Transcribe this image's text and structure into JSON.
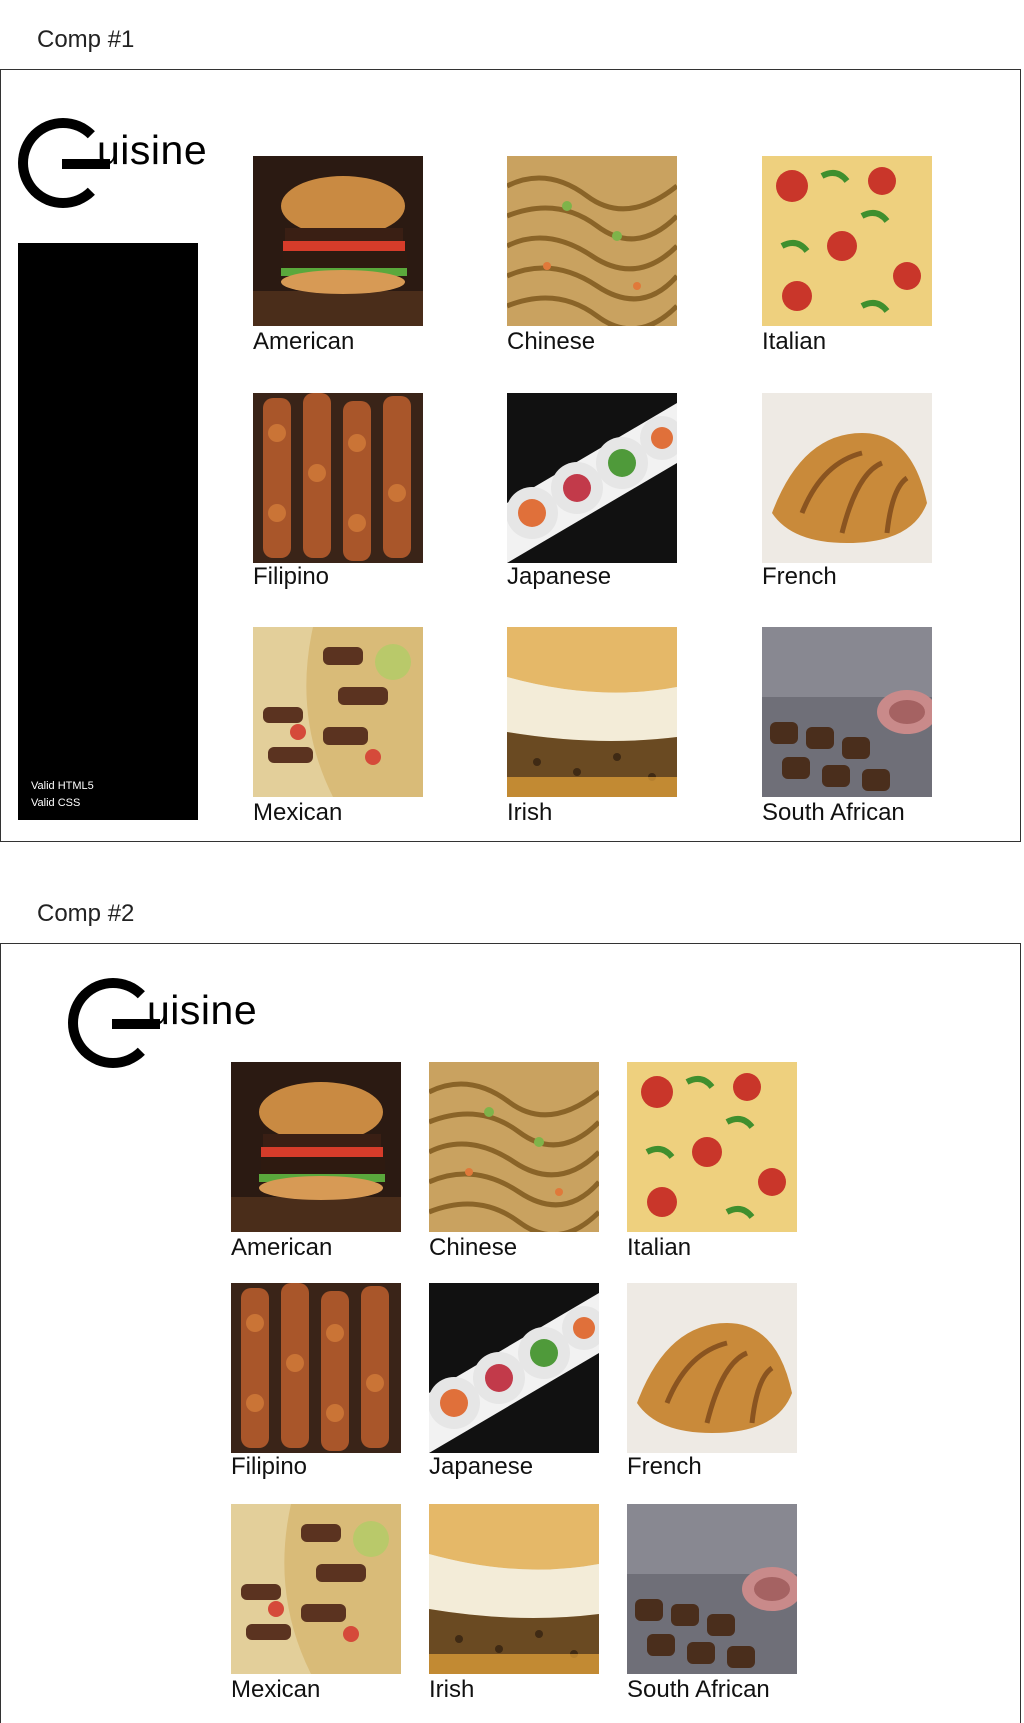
{
  "comp1": {
    "label": "Comp #1",
    "logo_text": "uisine",
    "sidebar": {
      "valid_html": "Valid HTML5",
      "valid_css": "Valid CSS"
    }
  },
  "comp2": {
    "label": "Comp #2",
    "logo_text": "uisine"
  },
  "cuisines": [
    {
      "name": "American",
      "icon": "burger-photo"
    },
    {
      "name": "Chinese",
      "icon": "noodles-photo"
    },
    {
      "name": "Italian",
      "icon": "pizza-photo"
    },
    {
      "name": "Filipino",
      "icon": "skewers-photo"
    },
    {
      "name": "Japanese",
      "icon": "sushi-photo"
    },
    {
      "name": "French",
      "icon": "croissant-photo"
    },
    {
      "name": "Mexican",
      "icon": "burrito-photo"
    },
    {
      "name": "Irish",
      "icon": "pie-photo"
    },
    {
      "name": "South African",
      "icon": "braai-photo"
    }
  ],
  "colors": {
    "sidebar": "#000000",
    "border": "#333333"
  }
}
